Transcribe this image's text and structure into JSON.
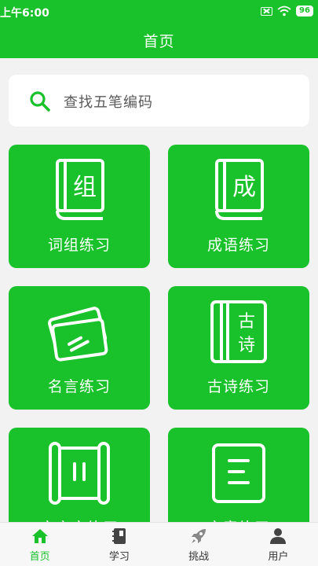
{
  "status": {
    "time": "上午6:00",
    "battery": "96"
  },
  "header": {
    "title": "首页"
  },
  "search": {
    "placeholder": "查找五笔编码"
  },
  "cards": [
    {
      "label": "词组练习",
      "icon": "book-zu-icon",
      "icon_char": "组"
    },
    {
      "label": "成语练习",
      "icon": "book-cheng-icon",
      "icon_char": "成"
    },
    {
      "label": "名言练习",
      "icon": "cards-icon"
    },
    {
      "label": "古诗练习",
      "icon": "gushi-scroll-icon",
      "icon_chars": [
        "古",
        "诗"
      ]
    },
    {
      "label": "文言文练习",
      "icon": "scroll-icon"
    },
    {
      "label": "文章练习",
      "icon": "document-icon"
    }
  ],
  "tabbar": {
    "items": [
      {
        "label": "首页",
        "icon": "home-icon",
        "active": true
      },
      {
        "label": "学习",
        "icon": "notebook-icon",
        "active": false
      },
      {
        "label": "挑战",
        "icon": "rocket-icon",
        "active": false
      },
      {
        "label": "用户",
        "icon": "user-icon",
        "active": false
      }
    ]
  },
  "colors": {
    "primary": "#19c12a",
    "background": "#f2f2f2"
  }
}
